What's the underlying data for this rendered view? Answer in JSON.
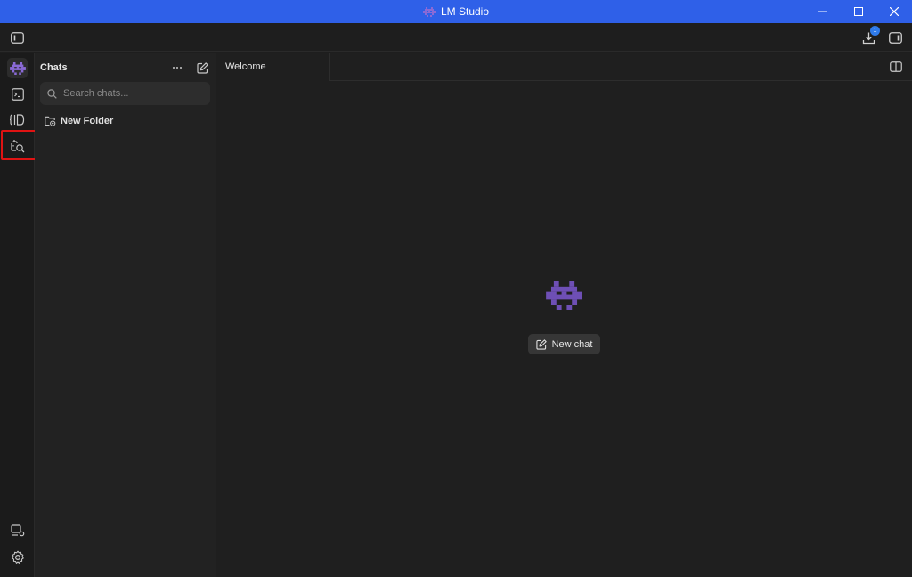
{
  "window": {
    "title": "LM Studio"
  },
  "toolbar": {
    "download_badge": "1"
  },
  "sidebar": {
    "title": "Chats",
    "search_placeholder": "Search chats...",
    "folder_label": "New Folder"
  },
  "main": {
    "tab_label": "Welcome",
    "new_chat_label": "New chat"
  },
  "colors": {
    "title_bar": "#2f60e8",
    "brand_purple": "#6e4fb5",
    "highlight": "#e01313"
  }
}
